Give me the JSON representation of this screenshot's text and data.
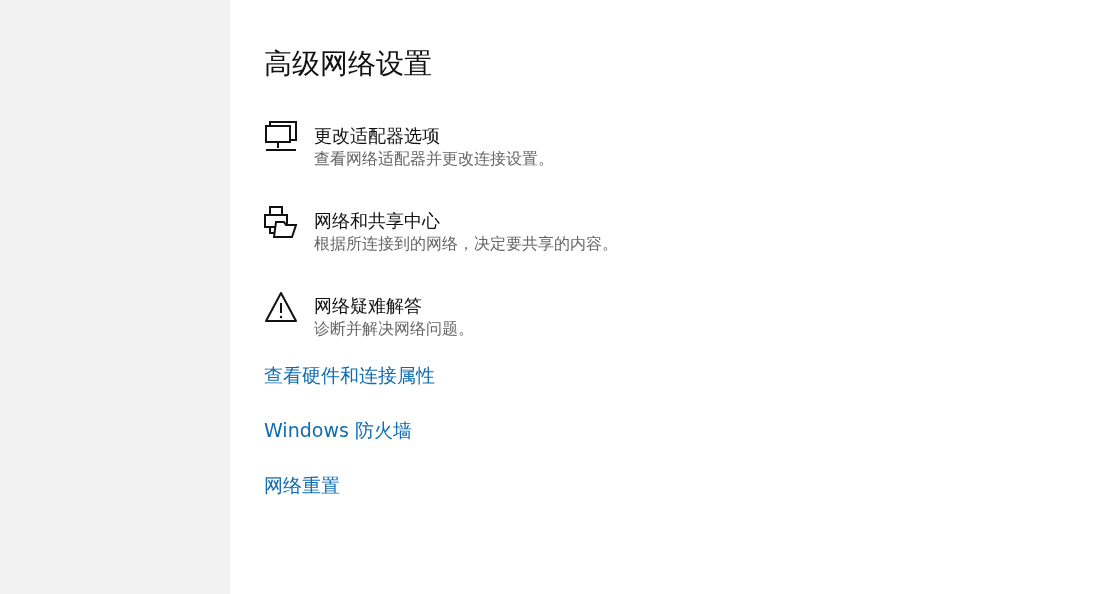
{
  "title": "高级网络设置",
  "options": [
    {
      "kind": "adapter",
      "title": "更改适配器选项",
      "description": "查看网络适配器并更改连接设置。"
    },
    {
      "kind": "sharing",
      "title": "网络和共享中心",
      "description": "根据所连接到的网络，决定要共享的内容。"
    },
    {
      "kind": "warning",
      "title": "网络疑难解答",
      "description": "诊断并解决网络问题。"
    }
  ],
  "links": [
    "查看硬件和连接属性",
    "Windows 防火墙",
    "网络重置"
  ]
}
